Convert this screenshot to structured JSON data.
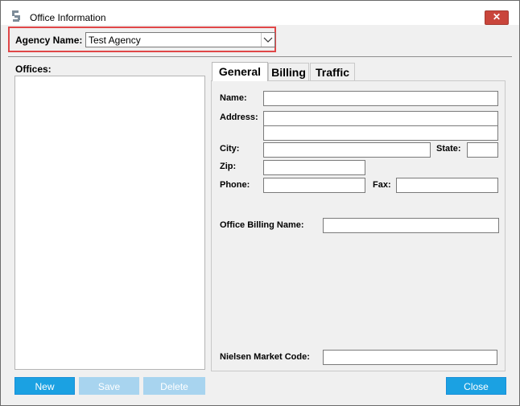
{
  "window": {
    "title": "Office Information",
    "close_glyph": "✕",
    "app_icon": "app-logo-icon"
  },
  "agency": {
    "label": "Agency Name:",
    "value": "Test Agency",
    "dropdown_icon": "chevron-down-icon"
  },
  "offices": {
    "label": "Offices:",
    "items": []
  },
  "tabs": [
    {
      "label": "General",
      "selected": true
    },
    {
      "label": "Billing",
      "selected": false
    },
    {
      "label": "Traffic",
      "selected": false
    }
  ],
  "general": {
    "name_label": "Name:",
    "address_label": "Address:",
    "city_label": "City:",
    "state_label": "State:",
    "zip_label": "Zip:",
    "phone_label": "Phone:",
    "fax_label": "Fax:",
    "office_billing_name_label": "Office Billing Name:",
    "nielsen_market_code_label": "Nielsen Market Code:",
    "name_value": "",
    "address1_value": "",
    "address2_value": "",
    "city_value": "",
    "state_value": "",
    "zip_value": "",
    "phone_value": "",
    "fax_value": "",
    "office_billing_name_value": "",
    "nielsen_market_code_value": ""
  },
  "buttons": {
    "new": "New",
    "save": "Save",
    "delete": "Delete",
    "close": "Close"
  },
  "colors": {
    "accent": "#1ba1e2",
    "disabled": "#a8d4ef",
    "highlight": "#e04748",
    "close": "#c9453b"
  }
}
